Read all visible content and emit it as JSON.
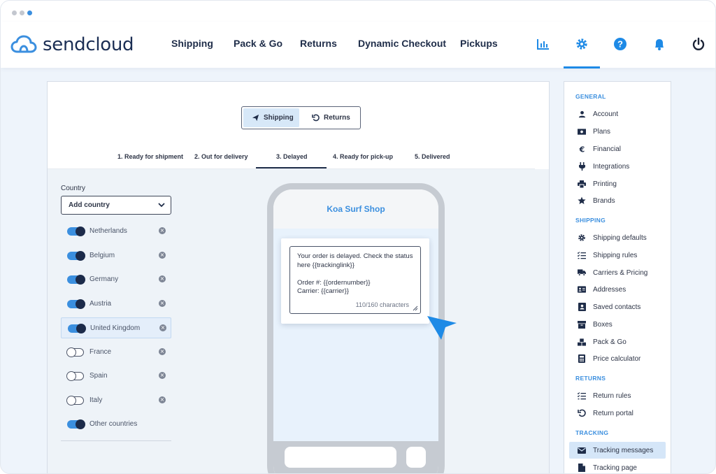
{
  "brand": {
    "name": "sendcloud",
    "accent": "#3b8fdf",
    "navy": "#1f2d49"
  },
  "nav": {
    "items": [
      "Shipping",
      "Pack & Go",
      "Returns",
      "Dynamic Checkout",
      "Pickups"
    ],
    "icons": [
      "analytics-icon",
      "gear-icon",
      "help-icon",
      "bell-icon",
      "power-icon"
    ],
    "active_icon": "gear-icon"
  },
  "mode_toggle": {
    "shipping": "Shipping",
    "returns": "Returns",
    "selected": "Shipping"
  },
  "steps": {
    "items": [
      "1. Ready for shipment",
      "2. Out for delivery",
      "3. Delayed",
      "4. Ready for pick-up",
      "5. Delivered"
    ],
    "active": "3. Delayed"
  },
  "country_panel": {
    "label": "Country",
    "select_value": "Add country",
    "countries": [
      {
        "name": "Netherlands",
        "enabled": true,
        "removable": true
      },
      {
        "name": "Belgium",
        "enabled": true,
        "removable": true
      },
      {
        "name": "Germany",
        "enabled": true,
        "removable": true
      },
      {
        "name": "Austria",
        "enabled": true,
        "removable": true
      },
      {
        "name": "United Kingdom",
        "enabled": true,
        "removable": true,
        "highlighted": true
      },
      {
        "name": "France",
        "enabled": false,
        "removable": true
      },
      {
        "name": "Spain",
        "enabled": false,
        "removable": true
      },
      {
        "name": "Italy",
        "enabled": false,
        "removable": true
      },
      {
        "name": "Other countries",
        "enabled": true,
        "removable": false
      }
    ]
  },
  "preview": {
    "shop_name": "Koa Surf Shop",
    "message_lines": [
      "Your order is delayed. Check the status",
      "here {{trackinglink}}",
      "",
      "Order #: {{ordernumber}}",
      "Carrier: {{carrier}}"
    ],
    "char_count": "110/160 characters"
  },
  "settings": {
    "general": {
      "heading": "GENERAL",
      "items": [
        "Account",
        "Plans",
        "Financial",
        "Integrations",
        "Printing",
        "Brands"
      ]
    },
    "shipping": {
      "heading": "SHIPPING",
      "items": [
        "Shipping defaults",
        "Shipping rules",
        "Carriers & Pricing",
        "Addresses",
        "Saved contacts",
        "Boxes",
        "Pack & Go",
        "Price calculator"
      ]
    },
    "returns": {
      "heading": "RETURNS",
      "items": [
        "Return rules",
        "Return portal"
      ]
    },
    "tracking": {
      "heading": "TRACKING",
      "items": [
        "Tracking messages",
        "Tracking page"
      ],
      "active": "Tracking messages"
    }
  }
}
